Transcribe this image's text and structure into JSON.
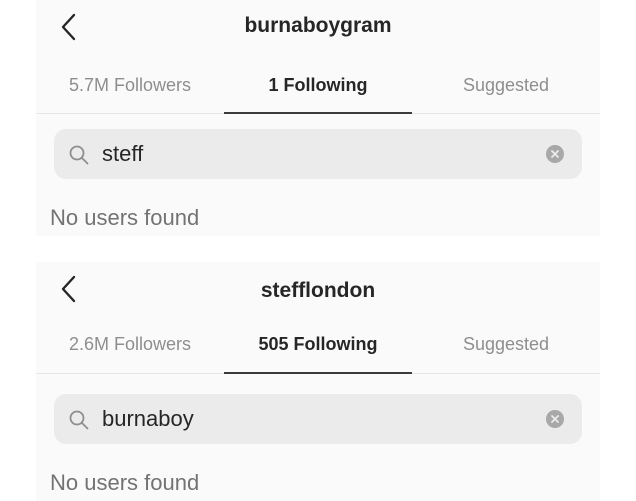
{
  "panels": [
    {
      "title": "burnaboygram",
      "tabs": [
        "5.7M Followers",
        "1 Following",
        "Suggested"
      ],
      "search_query": "steff",
      "empty_message": "No users found"
    },
    {
      "title": "stefflondon",
      "tabs": [
        "2.6M Followers",
        "505 Following",
        "Suggested"
      ],
      "search_query": "burnaboy",
      "empty_message": "No users found"
    }
  ],
  "icons": {
    "back": "chevron-left-icon",
    "search": "search-icon",
    "clear": "clear-circle-icon"
  },
  "colors": {
    "panel_bg": "#fafafa",
    "search_bg": "#ebebeb",
    "active_tab": "#262626",
    "inactive_tab": "#8e8e8e",
    "empty_text": "#737373"
  }
}
